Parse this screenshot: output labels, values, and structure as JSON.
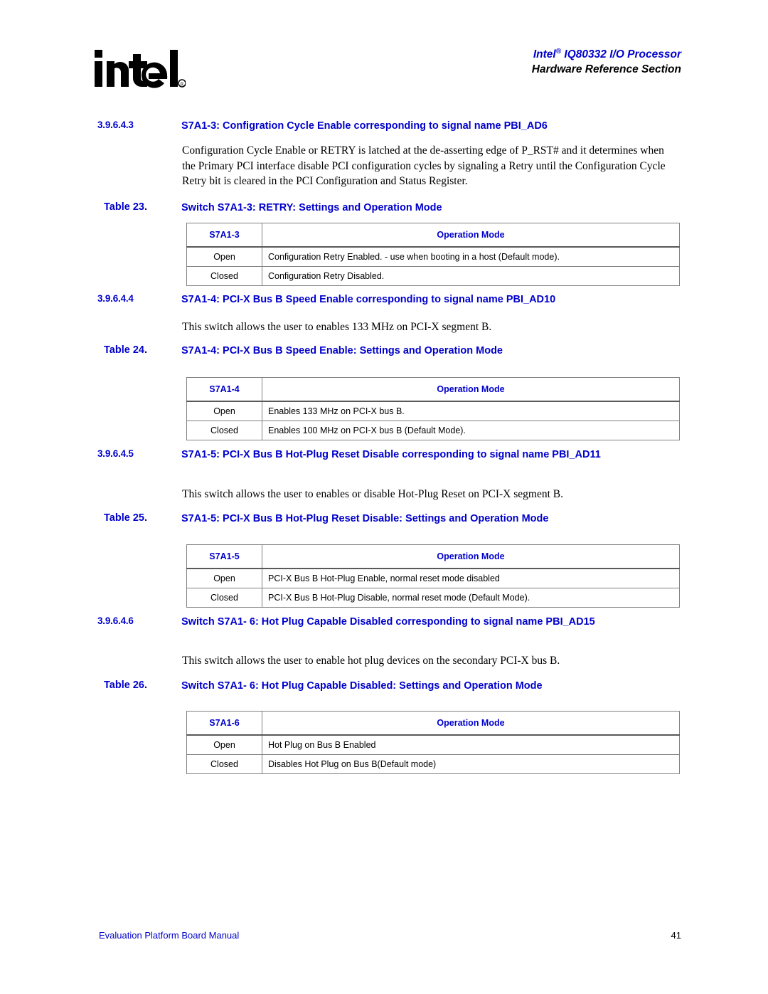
{
  "header": {
    "logo_alt": "intel-logo",
    "title_line1": "Intel",
    "title_line1_sup": "®",
    "title_line1_rest": " IQ80332 I/O Processor",
    "title_line2": "Hardware Reference Section"
  },
  "colors": {
    "heading_blue": "#0000cc",
    "table_border": "#808080",
    "table_header_rule": "#595959",
    "body_text": "#000000"
  },
  "sections": [
    {
      "number": "3.9.6.4.3",
      "title": "S7A1-3: Configration Cycle Enable corresponding to signal name PBI_AD6",
      "paragraph": "Configuration Cycle Enable or RETRY is latched at the de-asserting edge of P_RST# and it determines when the Primary PCI interface disable PCI configuration cycles by signaling a Retry until the Configuration Cycle Retry bit is cleared in the PCI Configuration and Status Register."
    },
    {
      "number": "3.9.6.4.4",
      "title": "S7A1-4: PCI-X Bus B Speed Enable corresponding to signal name PBI_AD10",
      "paragraph": "This switch allows the user to enables 133 MHz on PCI-X segment B."
    },
    {
      "number": "3.9.6.4.5",
      "title": "S7A1-5: PCI-X Bus B Hot-Plug Reset Disable corresponding to signal name PBI_AD11",
      "paragraph": "This switch allows the user to enables or disable Hot-Plug Reset on PCI-X segment B."
    },
    {
      "number": "3.9.6.4.6",
      "title": "Switch S7A1- 6: Hot Plug Capable Disabled corresponding to signal name PBI_AD15",
      "paragraph": "This switch allows the user to enable hot plug devices on the secondary PCI-X bus B."
    }
  ],
  "tables": [
    {
      "label": "Table 23.",
      "caption": "Switch S7A1-3: RETRY: Settings and Operation Mode",
      "columns": [
        "S7A1-3",
        "Operation Mode"
      ],
      "rows": [
        [
          "Open",
          "Configuration Retry Enabled. - use when booting in a host (Default mode)."
        ],
        [
          "Closed",
          "Configuration Retry Disabled."
        ]
      ]
    },
    {
      "label": "Table 24.",
      "caption": "S7A1-4: PCI-X Bus B Speed Enable: Settings and Operation Mode",
      "columns": [
        "S7A1-4",
        "Operation Mode"
      ],
      "rows": [
        [
          "Open",
          "Enables 133 MHz on PCI-X bus B."
        ],
        [
          "Closed",
          "Enables 100 MHz on PCI-X bus B (Default Mode)."
        ]
      ]
    },
    {
      "label": "Table 25.",
      "caption": "S7A1-5: PCI-X Bus B Hot-Plug Reset Disable: Settings and Operation Mode",
      "columns": [
        "S7A1-5",
        "Operation Mode"
      ],
      "rows": [
        [
          "Open",
          "PCI-X Bus B Hot-Plug Enable, normal reset mode disabled"
        ],
        [
          "Closed",
          "PCI-X Bus B Hot-Plug Disable, normal reset mode (Default Mode)."
        ]
      ]
    },
    {
      "label": "Table 26.",
      "caption": "Switch S7A1- 6: Hot Plug Capable Disabled: Settings and Operation Mode",
      "columns": [
        "S7A1-6",
        "Operation Mode"
      ],
      "rows": [
        [
          "Open",
          "Hot Plug on Bus B Enabled"
        ],
        [
          "Closed",
          "Disables Hot Plug on Bus B(Default mode)"
        ]
      ]
    }
  ],
  "footer": {
    "manual_title": "Evaluation Platform Board Manual",
    "page_number": "41"
  }
}
